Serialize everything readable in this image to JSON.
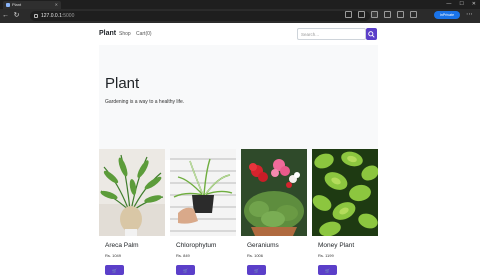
{
  "browser": {
    "tab_title": "Plant",
    "url_host": "127.0.0.1",
    "url_port": ":5000",
    "profile_label": "InPrivate"
  },
  "navbar": {
    "brand": "Plant",
    "links": [
      "Shop",
      "Cart(0)"
    ],
    "search_placeholder": "Search..."
  },
  "hero": {
    "title": "Plant",
    "subtitle": "Gardening is a way to a healthy life."
  },
  "products": [
    {
      "name": "Areca Palm",
      "price": "Rs. 1049",
      "image_icon": "areca-palm-photo"
    },
    {
      "name": "Chlorophytum",
      "price": "Rs. 849",
      "image_icon": "chlorophytum-photo"
    },
    {
      "name": "Geraniums",
      "price": "Rs. 1006",
      "image_icon": "geraniums-photo"
    },
    {
      "name": "Money Plant",
      "price": "Rs. 1199",
      "image_icon": "money-plant-photo"
    }
  ],
  "colors": {
    "accent": "#5b3fc9",
    "hero_bg": "#f8f9fa"
  }
}
